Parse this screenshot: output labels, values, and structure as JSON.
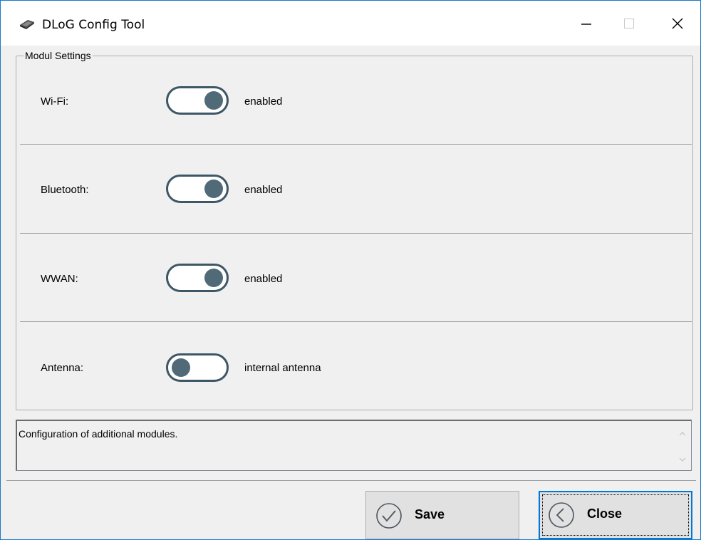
{
  "window": {
    "title": "DLoG Config Tool",
    "controls": {
      "minimize": "minimize",
      "maximize": "maximize",
      "close": "close"
    }
  },
  "group": {
    "legend": "Modul Settings",
    "rows": [
      {
        "label": "Wi-Fi:",
        "state": "enabled",
        "toggle_on": true
      },
      {
        "label": "Bluetooth:",
        "state": "enabled",
        "toggle_on": true
      },
      {
        "label": "WWAN:",
        "state": "enabled",
        "toggle_on": true
      },
      {
        "label": "Antenna:",
        "state": "internal antenna",
        "toggle_on": false
      }
    ]
  },
  "description": {
    "text": "Configuration of additional modules."
  },
  "buttons": {
    "save_label": "Save",
    "close_label": "Close"
  },
  "colors": {
    "title_border": "#1979ca",
    "toggle": "#3d5766",
    "focus": "#0078d7"
  },
  "icons": {
    "app": "device-icon",
    "save": "check-circle-icon",
    "close": "chevron-left-circle-icon"
  }
}
